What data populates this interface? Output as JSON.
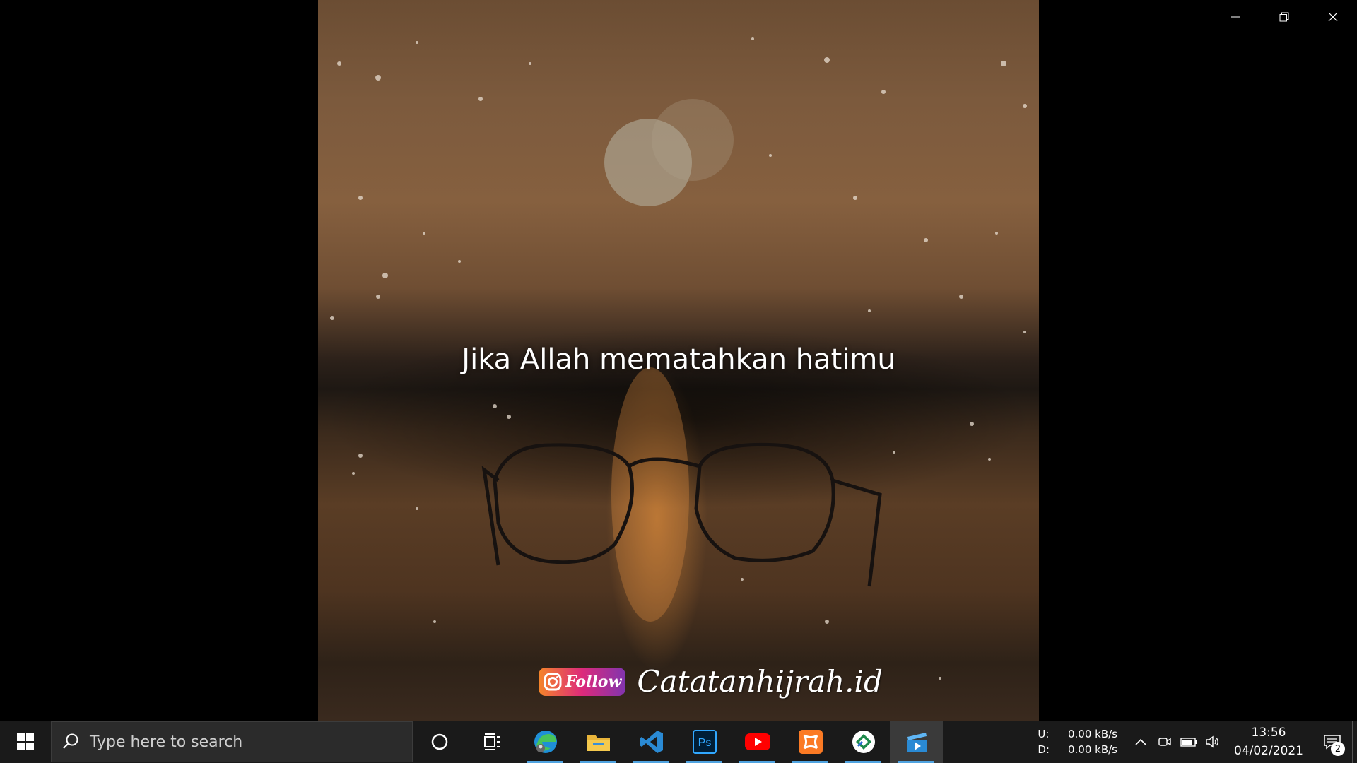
{
  "video": {
    "caption": "Jika Allah mematahkan hatimu",
    "watermark_follow": "Follow",
    "watermark_handle": "Catatanhijrah.id"
  },
  "taskbar": {
    "search_placeholder": "Type here to search",
    "apps": [
      {
        "icon": "cortana-icon"
      },
      {
        "icon": "task-view-icon"
      },
      {
        "icon": "edge-icon",
        "running": true
      },
      {
        "icon": "file-explorer-icon",
        "running": true
      },
      {
        "icon": "vscode-icon",
        "running": true
      },
      {
        "icon": "photoshop-icon",
        "label": "Ps",
        "running": true
      },
      {
        "icon": "youtube-icon",
        "running": true
      },
      {
        "icon": "xampp-icon",
        "running": true
      },
      {
        "icon": "greenshot-icon",
        "running": true
      },
      {
        "icon": "movies-tv-icon",
        "running": true,
        "active": true
      }
    ],
    "net_upload_label": "U:",
    "net_download_label": "D:",
    "net_upload_value": "0.00 kB/s",
    "net_download_value": "0.00 kB/s",
    "time": "13:56",
    "date": "04/02/2021",
    "notification_count": "2"
  },
  "colors": {
    "taskbar_bg": "#1a1a1a",
    "accent": "#4fa3e0",
    "youtube_red": "#ff0000",
    "photoshop_blue": "#31a8ff",
    "xampp_orange": "#fb7a24"
  }
}
